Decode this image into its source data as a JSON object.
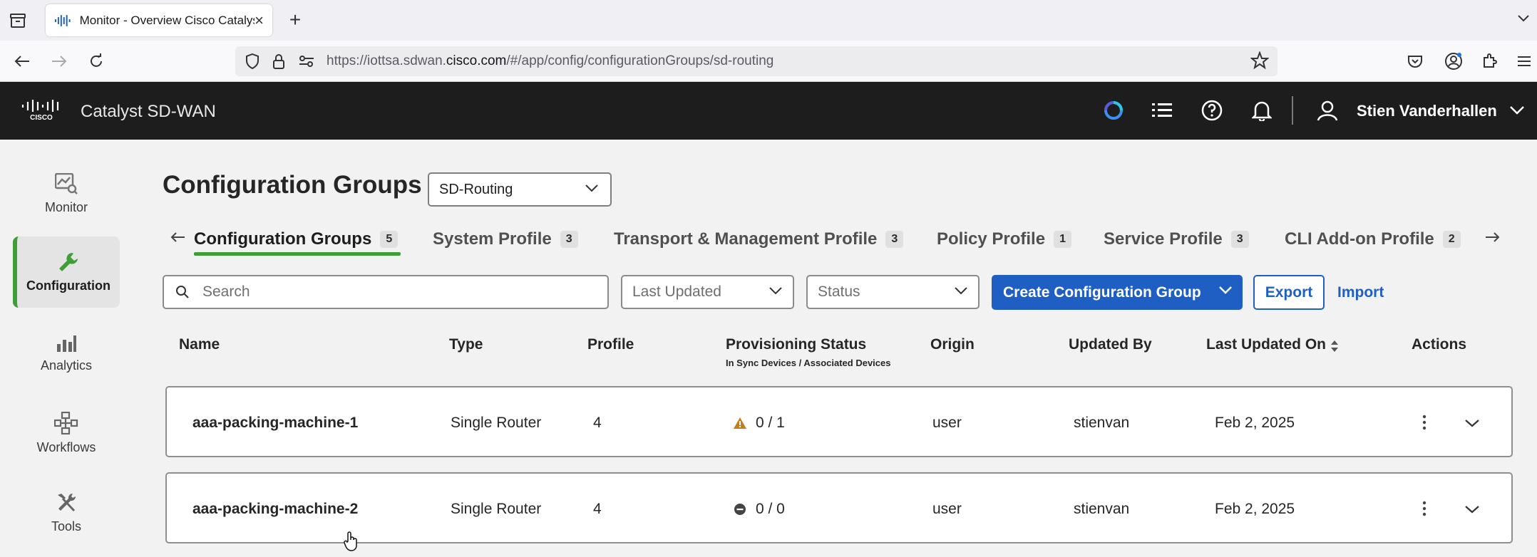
{
  "browser": {
    "tab_title": "Monitor - Overview Cisco Catalyst SD-WAN",
    "new_tab": "+",
    "close": "×",
    "url_prefix": "https://iottsa.sdwan.",
    "url_domain": "cisco.com",
    "url_suffix": "/#/app/config/configurationGroups/sd-routing"
  },
  "header": {
    "product": "Catalyst SD-WAN",
    "user": "Stien Vanderhallen",
    "brand_color": "#1d1d1d"
  },
  "leftnav": {
    "items": [
      {
        "label": "Monitor",
        "icon": "monitor-icon"
      },
      {
        "label": "Configuration",
        "icon": "wrench-icon",
        "active": true
      },
      {
        "label": "Analytics",
        "icon": "bar-chart-icon"
      },
      {
        "label": "Workflows",
        "icon": "workflows-icon"
      },
      {
        "label": "Tools",
        "icon": "tools-icon"
      }
    ]
  },
  "page": {
    "title": "Configuration Groups",
    "solution": "SD-Routing"
  },
  "tabs": [
    {
      "label": "Configuration Groups",
      "count": "5",
      "active": true
    },
    {
      "label": "System Profile",
      "count": "3"
    },
    {
      "label": "Transport & Management Profile",
      "count": "3"
    },
    {
      "label": "Policy Profile",
      "count": "1"
    },
    {
      "label": "Service Profile",
      "count": "3"
    },
    {
      "label": "CLI Add-on Profile",
      "count": "2"
    }
  ],
  "toolbar": {
    "search_placeholder": "Search",
    "last_updated_placeholder": "Last Updated",
    "status_placeholder": "Status",
    "create_label": "Create Configuration Group",
    "export_label": "Export",
    "import_label": "Import",
    "accent_color": "#1f5fc4"
  },
  "table": {
    "headers": {
      "name": "Name",
      "type": "Type",
      "profile": "Profile",
      "provisioning": "Provisioning Status",
      "provisioning_sub": "In Sync Devices / Associated Devices",
      "origin": "Origin",
      "updated_by": "Updated By",
      "last_updated_on": "Last Updated On",
      "actions": "Actions"
    },
    "rows": [
      {
        "name": "aaa-packing-machine-1",
        "type": "Single Router",
        "profile": "4",
        "status_icon": "warning-icon",
        "provisioning": "0 / 1",
        "origin": "user",
        "updated_by": "stienvan",
        "last_updated_on": "Feb 2, 2025"
      },
      {
        "name": "aaa-packing-machine-2",
        "type": "Single Router",
        "profile": "4",
        "status_icon": "minus-circle-icon",
        "provisioning": "0 / 0",
        "origin": "user",
        "updated_by": "stienvan",
        "last_updated_on": "Feb 2, 2025"
      }
    ]
  }
}
